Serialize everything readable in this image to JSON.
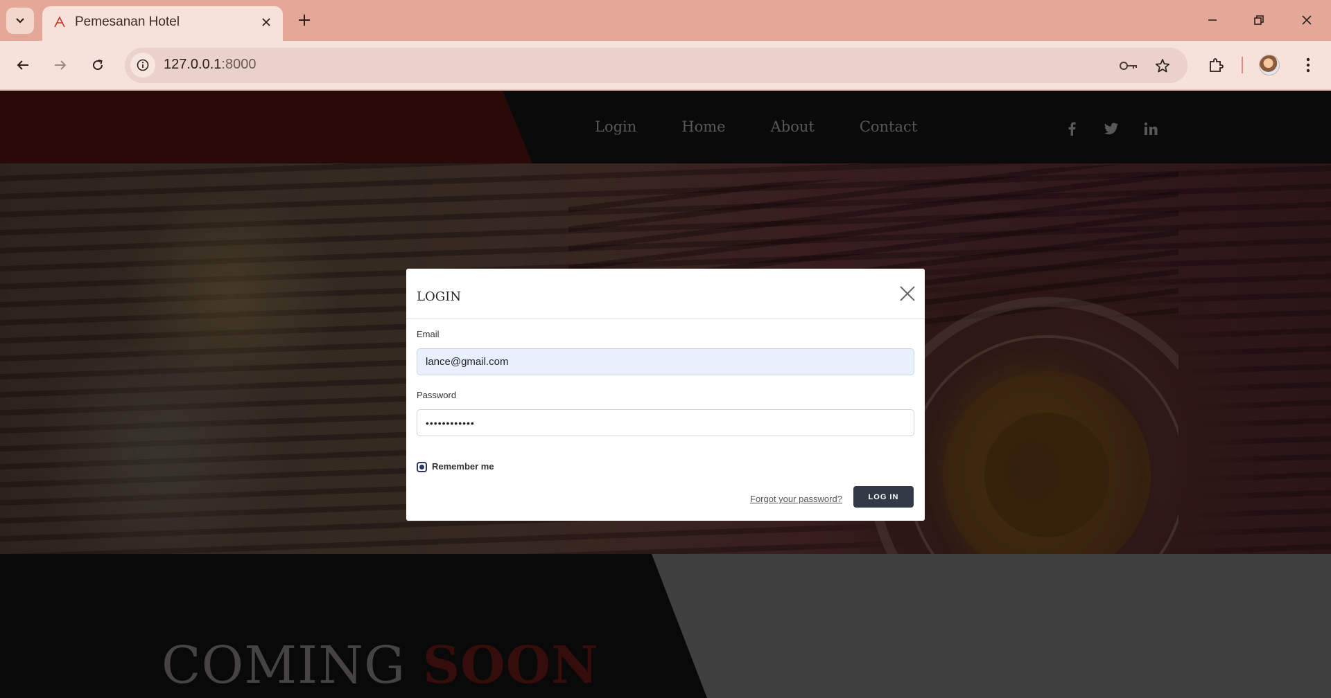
{
  "browser": {
    "tab_title": "Pemesanan Hotel",
    "url_host": "127.0.0.1",
    "url_port": ":8000"
  },
  "site": {
    "nav": [
      "Login",
      "Home",
      "About",
      "Contact"
    ],
    "social_icons": [
      "facebook-icon",
      "twitter-icon",
      "linkedin-icon"
    ],
    "coming_word1": "COMING",
    "coming_word2": "SOON"
  },
  "modal": {
    "title": "LOGIN",
    "email_label": "Email",
    "email_value": "lance@gmail.com",
    "password_label": "Password",
    "password_value": "••••••••••••",
    "remember_label": "Remember me",
    "remember_checked": true,
    "forgot_link": "Forgot your password?",
    "login_button": "LOG IN"
  },
  "colors": {
    "chrome": "#e3a898",
    "toolbar": "#f7e1db",
    "header_red": "#531512",
    "header_dark": "#141414",
    "button_dark": "#323a47",
    "soon_red": "#6a1a16"
  }
}
